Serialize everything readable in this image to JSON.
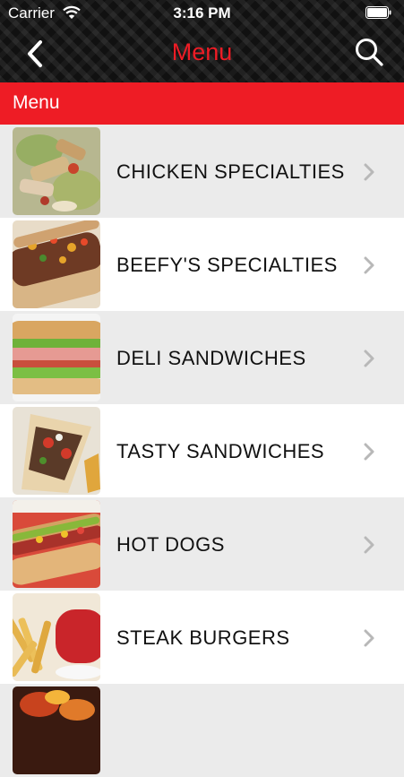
{
  "status_bar": {
    "carrier": "Carrier",
    "time": "3:16 PM",
    "icons": [
      "wifi-icon",
      "battery-icon"
    ]
  },
  "nav": {
    "title": "Menu",
    "back_icon": "chevron-left-icon",
    "search_icon": "search-icon",
    "title_color": "#ee1c25"
  },
  "section": {
    "title": "Menu",
    "color": "#ee1c25"
  },
  "menu_items": [
    {
      "label": "CHICKEN SPECIALTIES",
      "thumbnail": "chicken-specialties-photo"
    },
    {
      "label": "BEEFY'S SPECIALTIES",
      "thumbnail": "beef-sandwich-photo"
    },
    {
      "label": "DELI SANDWICHES",
      "thumbnail": "deli-sandwich-photo"
    },
    {
      "label": "TASTY SANDWICHES",
      "thumbnail": "gyro-sandwich-photo"
    },
    {
      "label": "HOT DOGS",
      "thumbnail": "hot-dog-photo"
    },
    {
      "label": "STEAK BURGERS",
      "thumbnail": "burger-fries-photo"
    },
    {
      "label": "",
      "thumbnail": "grill-photo"
    }
  ],
  "colors": {
    "row_alt": "#ebebeb",
    "row": "#ffffff",
    "chevron": "#b8b8b8"
  }
}
